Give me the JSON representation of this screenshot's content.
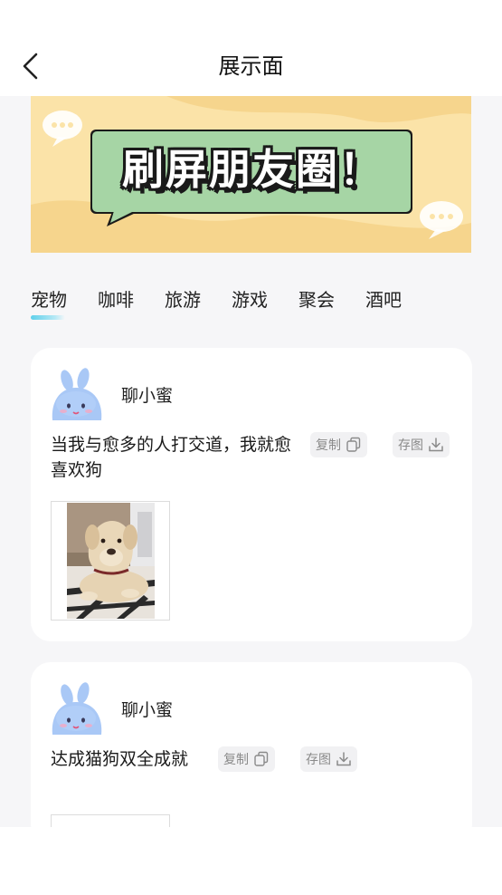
{
  "header": {
    "title": "展示面"
  },
  "banner": {
    "text": "刷屏朋友圈！"
  },
  "tabs": [
    {
      "label": "宠物"
    },
    {
      "label": "咖啡"
    },
    {
      "label": "旅游"
    },
    {
      "label": "游戏"
    },
    {
      "label": "聚会"
    },
    {
      "label": "酒吧"
    }
  ],
  "posts": [
    {
      "author": "聊小蜜",
      "text": "当我与愈多的人打交道，我就愈喜欢狗",
      "copy_label": "复制",
      "save_label": "存图"
    },
    {
      "author": "聊小蜜",
      "text": "达成猫狗双全成就",
      "copy_label": "复制",
      "save_label": "存图"
    }
  ],
  "colors": {
    "page_bg": "#f6f6f8",
    "banner_bg": "#fbe3a8",
    "banner_bubble": "#a6d5a5",
    "tab_indicator": "#5fd0ea",
    "avatar": "#a9c8f6"
  }
}
